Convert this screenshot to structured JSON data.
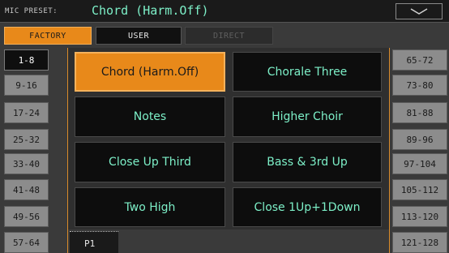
{
  "header": {
    "label": "MIC PRESET:",
    "value": "Chord (Harm.Off)"
  },
  "tabs": [
    {
      "label": "FACTORY",
      "state": "selected"
    },
    {
      "label": "USER",
      "state": "normal"
    },
    {
      "label": "DIRECT",
      "state": "disabled"
    }
  ],
  "banks_left": [
    "1-8",
    "9-16",
    "17-24",
    "25-32",
    "33-40",
    "41-48",
    "49-56",
    "57-64"
  ],
  "banks_right": [
    "65-72",
    "73-80",
    "81-88",
    "89-96",
    "97-104",
    "105-112",
    "113-120",
    "121-128"
  ],
  "selected_bank": "1-8",
  "presets": [
    "Chord (Harm.Off)",
    "Chorale Three",
    "Notes",
    "Higher Choir",
    "Close Up Third",
    "Bass & 3rd Up",
    "Two High",
    "Close 1Up+1Down"
  ],
  "selected_preset": "Chord (Harm.Off)",
  "page": "P1",
  "colors": {
    "accent": "#e8891a",
    "text_green": "#7df0c8",
    "background": "#3a3a3a"
  },
  "icons": {
    "dropdown": "chevron-down-icon"
  }
}
